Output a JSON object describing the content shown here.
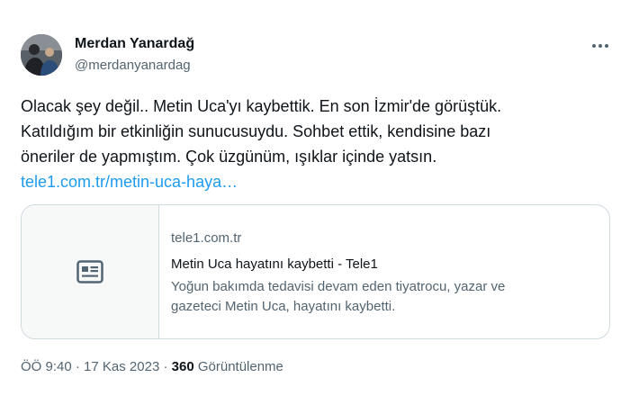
{
  "author": {
    "display_name": "Merdan Yanardağ",
    "handle": "@merdanyanardag",
    "avatar_icon": "profile-photo"
  },
  "more_icon": "more-horizontal-icon",
  "tweet": {
    "lines": [
      "Olacak şey değil.. Metin Uca'yı kaybettik. En son İzmir'de görüştük.",
      "Katıldığım bir etkinliğin sunucusuydu. Sohbet ettik, kendisine bazı",
      "öneriler de yapmıştım. Çok üzgünüm, ışıklar içinde yatsın."
    ],
    "link_text": "tele1.com.tr/metin-uca-haya…"
  },
  "card": {
    "thumbnail_icon": "article-icon",
    "domain": "tele1.com.tr",
    "title": "Metin Uca hayatını kaybetti - Tele1",
    "description_lines": [
      "Yoğun bakımda tedavisi devam eden tiyatrocu, yazar ve",
      "gazeteci Metin Uca, hayatını kaybetti."
    ]
  },
  "meta": {
    "time": "ÖÖ 9:40",
    "separator": "·",
    "date": "17 Kas 2023",
    "views_count": "360",
    "views_label": "Görüntülenme"
  },
  "colors": {
    "link": "#1d9bf0",
    "text": "#0f1419",
    "secondary": "#536471",
    "border": "#cfd9de"
  }
}
